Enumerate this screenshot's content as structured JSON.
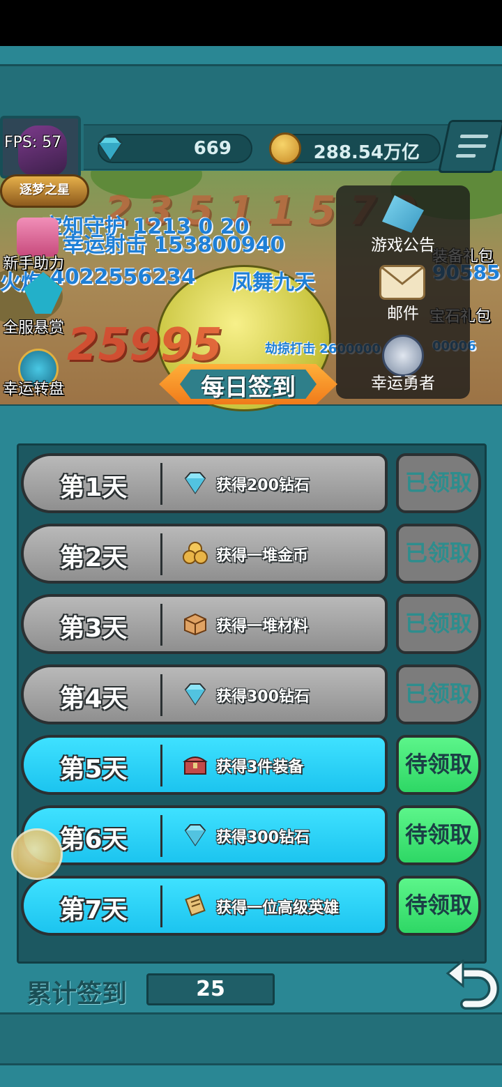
{
  "hud": {
    "fps": "FPS: 57",
    "rank_title": "逐梦之星",
    "diamonds": "669",
    "gold": "288.54万亿"
  },
  "side_menu": {
    "left": [
      "新手助力",
      "全服悬赏",
      "幸运转盘"
    ],
    "right": [
      "装备礼包",
      "宝石礼包"
    ]
  },
  "overlay_menu": {
    "items": [
      "游戏公告",
      "邮件",
      "幸运勇者"
    ]
  },
  "battle_text": {
    "skill_1": "幸运射击 153800940",
    "skill_2": "4022556234",
    "skill_3": "凤舞九天",
    "skill_4": "劫掠打击 2600000",
    "skill_4_tail": "00006",
    "big_number": "25995",
    "right_number": "90585"
  },
  "dialog": {
    "title": "每日签到",
    "rows": [
      {
        "day": "第1天",
        "reward": "获得200钻石",
        "icon": "diamond-icon",
        "status": "已领取",
        "claimed": true
      },
      {
        "day": "第2天",
        "reward": "获得一堆金币",
        "icon": "coin-pile-icon",
        "status": "已领取",
        "claimed": true
      },
      {
        "day": "第3天",
        "reward": "获得一堆材料",
        "icon": "material-box-icon",
        "status": "已领取",
        "claimed": true
      },
      {
        "day": "第4天",
        "reward": "获得300钻石",
        "icon": "diamond-icon",
        "status": "已领取",
        "claimed": true
      },
      {
        "day": "第5天",
        "reward": "获得3件装备",
        "icon": "treasure-chest-icon",
        "status": "待领取",
        "claimed": false
      },
      {
        "day": "第6天",
        "reward": "获得300钻石",
        "icon": "diamond-icon",
        "status": "待领取",
        "claimed": false
      },
      {
        "day": "第7天",
        "reward": "获得一位高级英雄",
        "icon": "scroll-icon",
        "status": "待领取",
        "claimed": false
      }
    ],
    "total_label": "累计签到",
    "total_value": "25"
  },
  "colors": {
    "claimed_row": "#a8a8a8",
    "pending_row": "#29d3f7",
    "pending_button": "#3ee874",
    "frame": "#2a8794"
  }
}
